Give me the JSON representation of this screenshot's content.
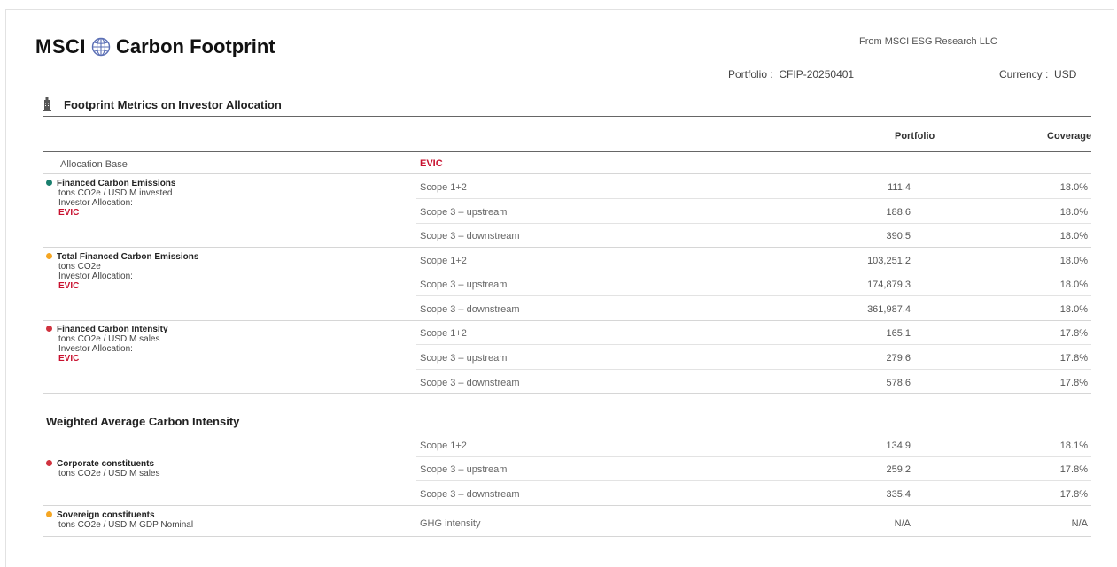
{
  "header": {
    "logo": "MSCI",
    "globe_icon": "globe-icon",
    "title": "Carbon Footprint",
    "from": "From MSCI ESG Research LLC",
    "portfolio_label": "Portfolio :",
    "portfolio_value": "CFIP-20250401",
    "currency_label": "Currency :",
    "currency_value": "USD"
  },
  "section1": {
    "title": "Footprint Metrics on Investor Allocation",
    "icon": "building-icon",
    "col_portfolio": "Portfolio",
    "col_coverage": "Coverage",
    "allocation_base_label": "Allocation Base",
    "allocation_base_value": "EVIC",
    "metrics": [
      {
        "name": "Financed Carbon Emissions",
        "unit": "tons CO2e / USD M invested",
        "alloc_label": "Investor Allocation:",
        "alloc_value": "EVIC",
        "dot_color": "#1a7f6e",
        "rows": [
          {
            "scope": "Scope 1+2",
            "portfolio": "111.4",
            "coverage": "18.0%"
          },
          {
            "scope": "Scope 3 – upstream",
            "portfolio": "188.6",
            "coverage": "18.0%"
          },
          {
            "scope": "Scope 3 – downstream",
            "portfolio": "390.5",
            "coverage": "18.0%"
          }
        ]
      },
      {
        "name": "Total Financed Carbon Emissions",
        "unit": "tons CO2e",
        "alloc_label": "Investor Allocation:",
        "alloc_value": "EVIC",
        "dot_color": "#f5a623",
        "rows": [
          {
            "scope": "Scope 1+2",
            "portfolio": "103,251.2",
            "coverage": "18.0%"
          },
          {
            "scope": "Scope 3 – upstream",
            "portfolio": "174,879.3",
            "coverage": "18.0%"
          },
          {
            "scope": "Scope 3 – downstream",
            "portfolio": "361,987.4",
            "coverage": "18.0%"
          }
        ]
      },
      {
        "name": "Financed Carbon Intensity",
        "unit": "tons CO2e / USD M sales",
        "alloc_label": "Investor Allocation:",
        "alloc_value": "EVIC",
        "dot_color": "#d0333f",
        "rows": [
          {
            "scope": "Scope 1+2",
            "portfolio": "165.1",
            "coverage": "17.8%"
          },
          {
            "scope": "Scope 3 – upstream",
            "portfolio": "279.6",
            "coverage": "17.8%"
          },
          {
            "scope": "Scope 3 – downstream",
            "portfolio": "578.6",
            "coverage": "17.8%"
          }
        ]
      }
    ]
  },
  "section2": {
    "title": "Weighted Average Carbon Intensity",
    "corporate": {
      "name": "Corporate constituents",
      "unit": "tons CO2e / USD M sales",
      "dot_color": "#d0333f",
      "rows": [
        {
          "scope": "Scope 1+2",
          "portfolio": "134.9",
          "coverage": "18.1%"
        },
        {
          "scope": "Scope 3 – upstream",
          "portfolio": "259.2",
          "coverage": "17.8%"
        },
        {
          "scope": "Scope 3 – downstream",
          "portfolio": "335.4",
          "coverage": "17.8%"
        }
      ]
    },
    "sovereign": {
      "name": "Sovereign constituents",
      "unit": "tons CO2e / USD M GDP Nominal",
      "dot_color": "#f5a623",
      "rows": [
        {
          "scope": "GHG intensity",
          "portfolio": "N/A",
          "coverage": "N/A"
        }
      ]
    }
  }
}
